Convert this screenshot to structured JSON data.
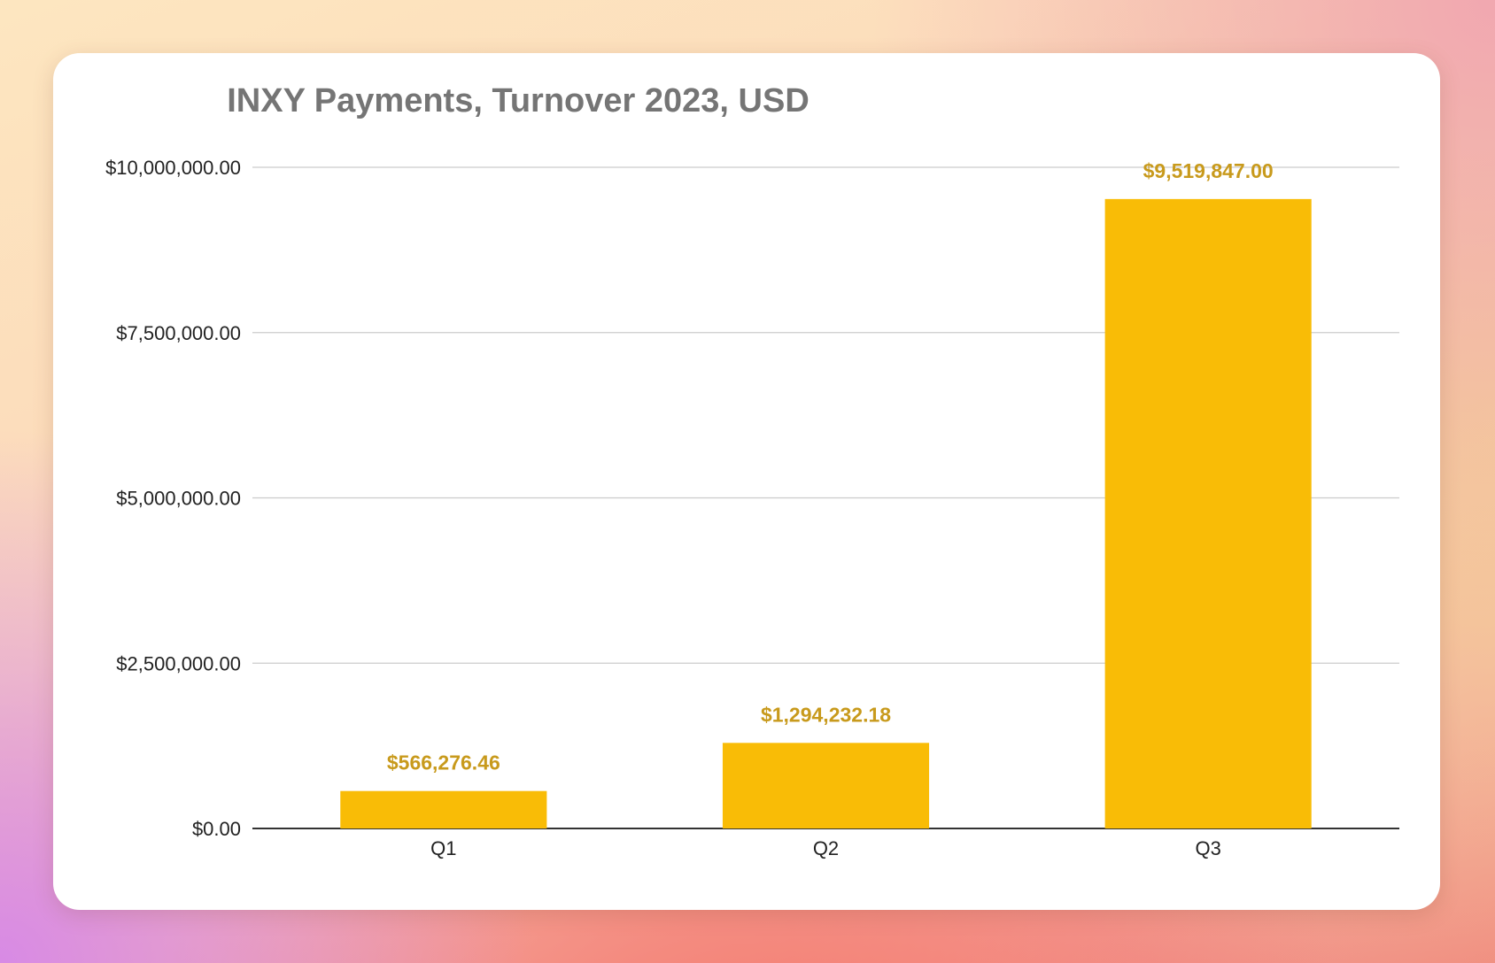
{
  "chart_data": {
    "type": "bar",
    "title": "INXY Payments, Turnover 2023, USD",
    "categories": [
      "Q1",
      "Q2",
      "Q3"
    ],
    "values": [
      566276.46,
      1294232.18,
      9519847.0
    ],
    "data_labels": [
      "$566,276.46",
      "$1,294,232.18",
      "$9,519,847.00"
    ],
    "ylim": [
      0,
      10000000
    ],
    "yticks": [
      {
        "value": 0,
        "label": "$0.00"
      },
      {
        "value": 2500000,
        "label": "$2,500,000.00"
      },
      {
        "value": 5000000,
        "label": "$5,000,000.00"
      },
      {
        "value": 7500000,
        "label": "$7,500,000.00"
      },
      {
        "value": 10000000,
        "label": "$10,000,000.00"
      }
    ],
    "xlabel": "",
    "ylabel": "",
    "grid": true,
    "legend": "none",
    "colors": {
      "bar": "#f9bc06",
      "data_label": "#c89a1c",
      "title": "#757575",
      "gridline": "#cccccc",
      "axis": "#333333"
    }
  }
}
